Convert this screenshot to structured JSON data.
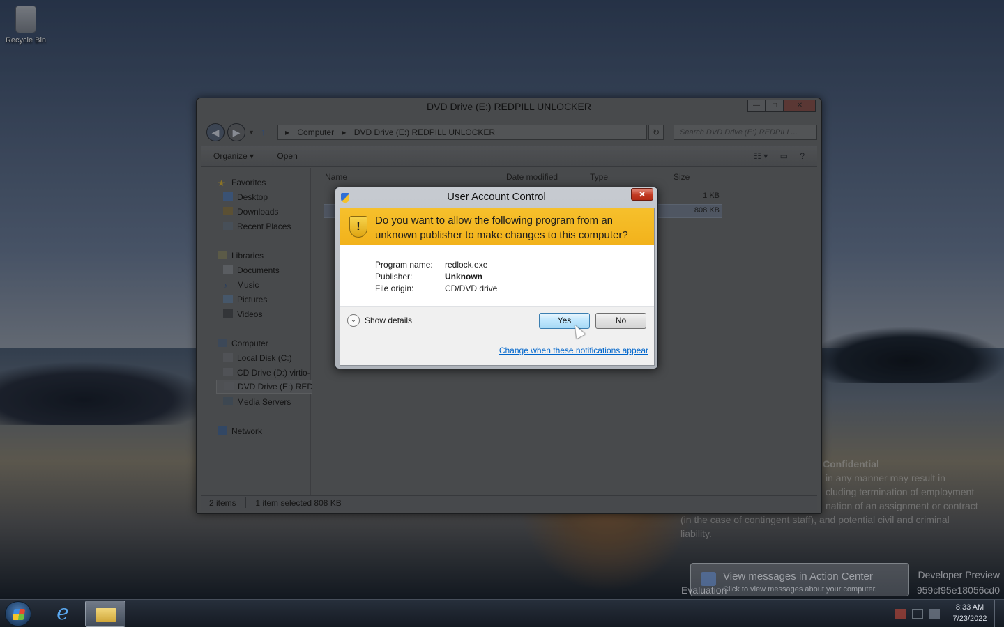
{
  "desktop": {
    "recycle_bin_label": "Recycle Bin",
    "watermark": {
      "heading": "Confidential",
      "lines": [
        "in any manner may result in",
        "cluding termination of employment",
        "nation of an assignment or contract",
        "(in the case of contingent staff), and potential civil and criminal",
        "liability."
      ],
      "developer_preview": "Developer Preview",
      "evaluation": "Evaluation",
      "build_id": "959cf95e18056cd0"
    }
  },
  "explorer": {
    "title": "DVD Drive (E:) REDPILL UNLOCKER",
    "address": [
      "Computer",
      "DVD Drive (E:) REDPILL UNLOCKER"
    ],
    "search_placeholder": "Search DVD Drive (E:) REDPILL...",
    "toolbar": {
      "organize": "Organize ▾",
      "open": "Open"
    },
    "columns": {
      "name": "Name",
      "date_modified": "Date modified",
      "type": "Type",
      "size": "Size"
    },
    "file_sizes": [
      "1 KB",
      "808 KB"
    ],
    "nav": {
      "favorites": "Favorites",
      "desktop": "Desktop",
      "downloads": "Downloads",
      "recent_places": "Recent Places",
      "libraries": "Libraries",
      "documents": "Documents",
      "music": "Music",
      "pictures": "Pictures",
      "videos": "Videos",
      "computer": "Computer",
      "local_disk": "Local Disk (C:)",
      "cd_drive": "CD Drive (D:) virtio-",
      "dvd_drive": "DVD Drive (E:) REDPILL UNLOCKER",
      "media_servers": "Media Servers",
      "network": "Network"
    },
    "status": {
      "items": "2 items",
      "selected": "1 item selected  808 KB"
    }
  },
  "uac": {
    "title": "User Account Control",
    "question": "Do you want to allow the following program from an unknown publisher to make changes to this computer?",
    "program_name_label": "Program name:",
    "program_name": "redlock.exe",
    "publisher_label": "Publisher:",
    "publisher": "Unknown",
    "file_origin_label": "File origin:",
    "file_origin": "CD/DVD drive",
    "show_details": "Show details",
    "yes": "Yes",
    "no": "No",
    "notifications_link": "Change when these notifications appear"
  },
  "action_center": {
    "title": "View messages in Action Center",
    "subtitle": "Click to view messages about your computer."
  },
  "taskbar": {
    "time": "8:33 AM",
    "date": "7/23/2022"
  }
}
